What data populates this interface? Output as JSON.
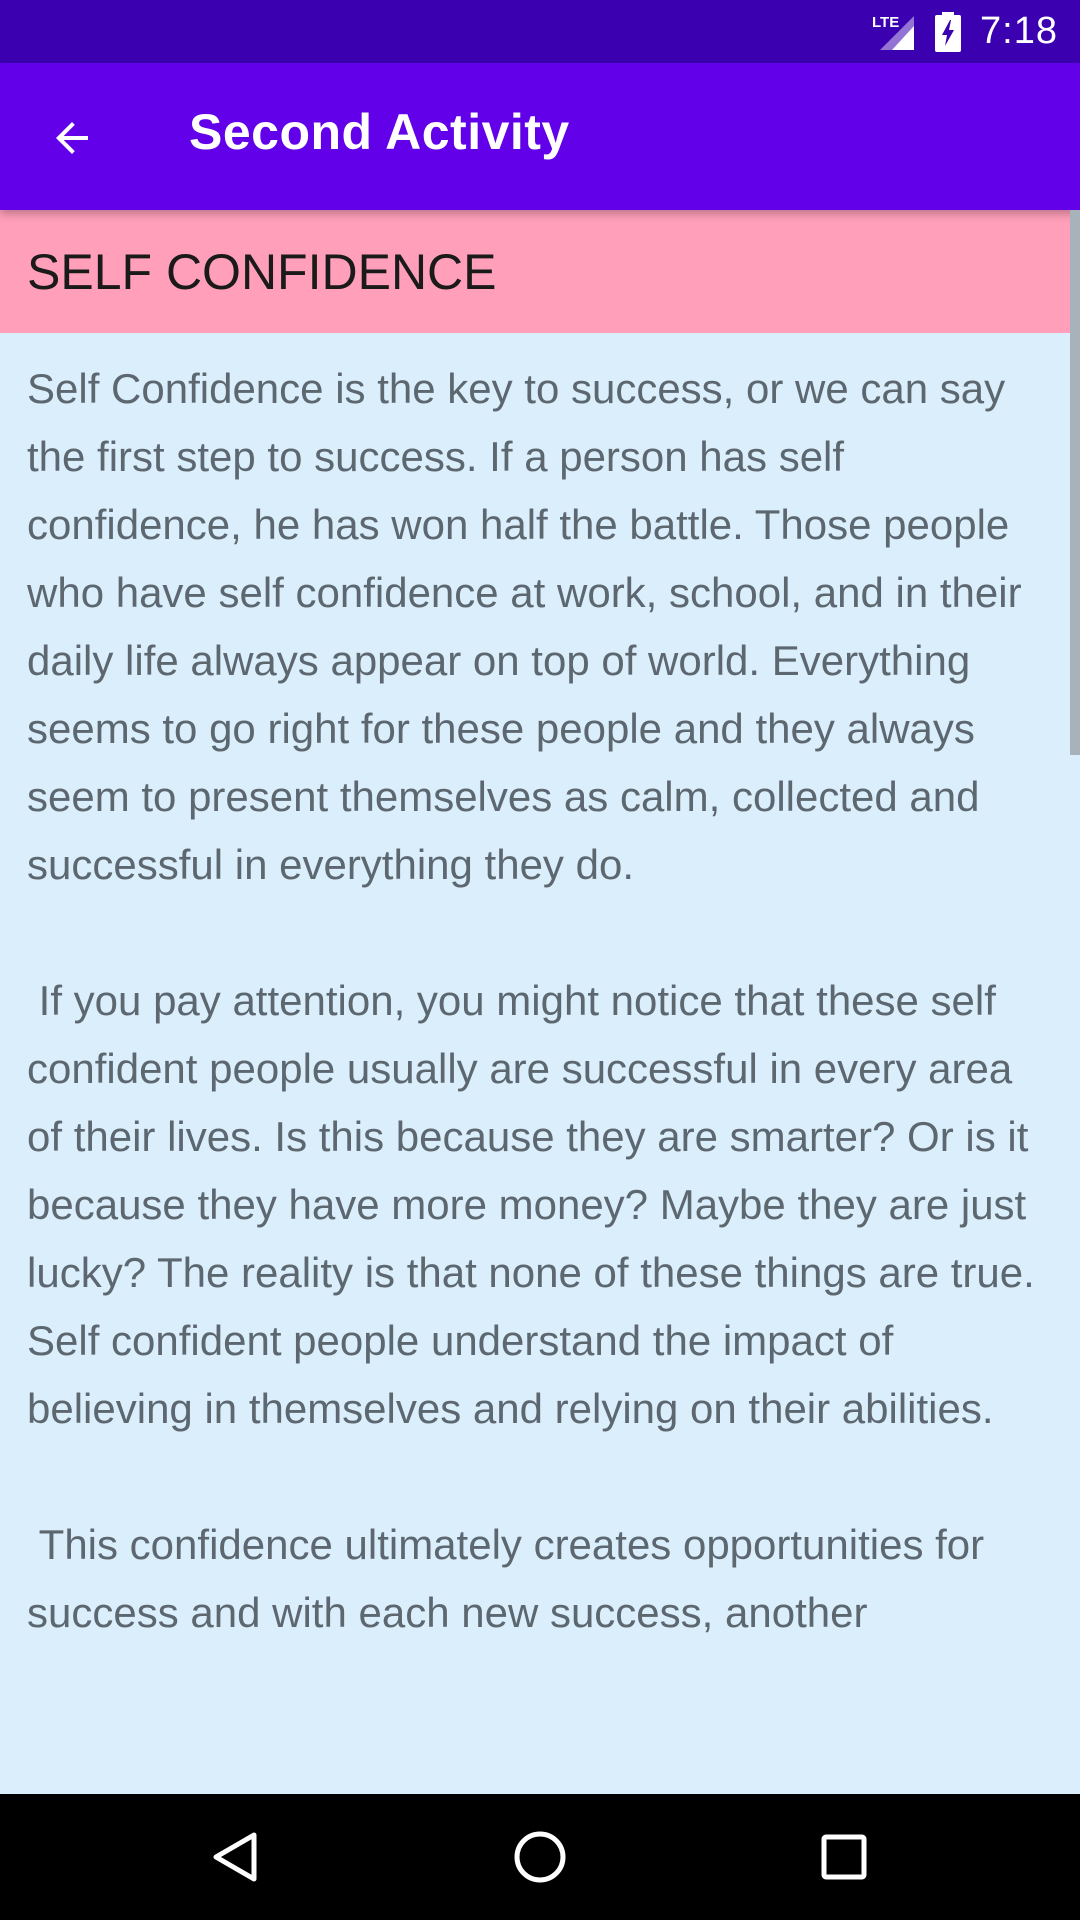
{
  "status_bar": {
    "network_label": "LTE",
    "time": "7:18"
  },
  "app_bar": {
    "title": "Second Activity",
    "back_icon": "arrow-back-icon"
  },
  "content": {
    "heading": "SELF CONFIDENCE",
    "paragraphs": [
      "Self Confidence is the key to success, or we can say the first step to success. If a person has self confidence, he has won half the battle. Those people who have self confidence at work, school, and in their daily life always appear on top of world. Everything seems to go right for these people and they always seem to present themselves as calm, collected and successful in everything they do.",
      " If you pay attention, you might notice that these self confident people usually are successful in every area of their lives. Is this because they are smarter? Or is it because they have more money? Maybe they are just lucky? The reality is that none of these things are true. Self confident people understand the impact of believing in themselves and relying on their abilities.",
      " This confidence ultimately creates opportunities for success and with each new success, another"
    ]
  },
  "colors": {
    "status_bar": "#3b00b0",
    "app_bar": "#6200ea",
    "heading_bg": "#ff9fb9",
    "content_bg": "#daeefc",
    "body_text": "#5d6770"
  },
  "nav_bar": {
    "back_icon": "nav-back-triangle-icon",
    "home_icon": "nav-home-circle-icon",
    "recents_icon": "nav-recents-square-icon"
  }
}
